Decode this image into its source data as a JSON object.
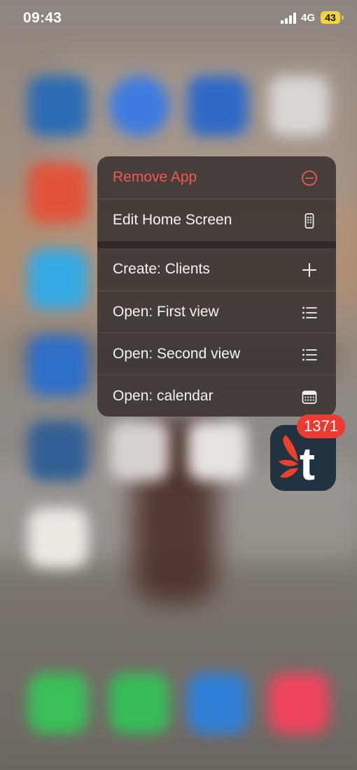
{
  "status_bar": {
    "time": "09:43",
    "network": "4G",
    "battery": "43"
  },
  "context_menu": {
    "items": [
      {
        "label": "Remove App",
        "icon": "minus-circle-icon",
        "destructive": true,
        "color": "#ee5a52"
      },
      {
        "label": "Edit Home Screen",
        "icon": "phone-icon"
      },
      {
        "label": "Create: Clients",
        "icon": "plus-icon"
      },
      {
        "label": "Open: First view",
        "icon": "list-icon"
      },
      {
        "label": "Open: Second view",
        "icon": "list-icon"
      },
      {
        "label": "Open: calendar",
        "icon": "calendar-icon"
      }
    ]
  },
  "app": {
    "badge_count": "1371",
    "icon_color": "#213341",
    "accent_color": "#e8412e",
    "glyph": "t"
  }
}
